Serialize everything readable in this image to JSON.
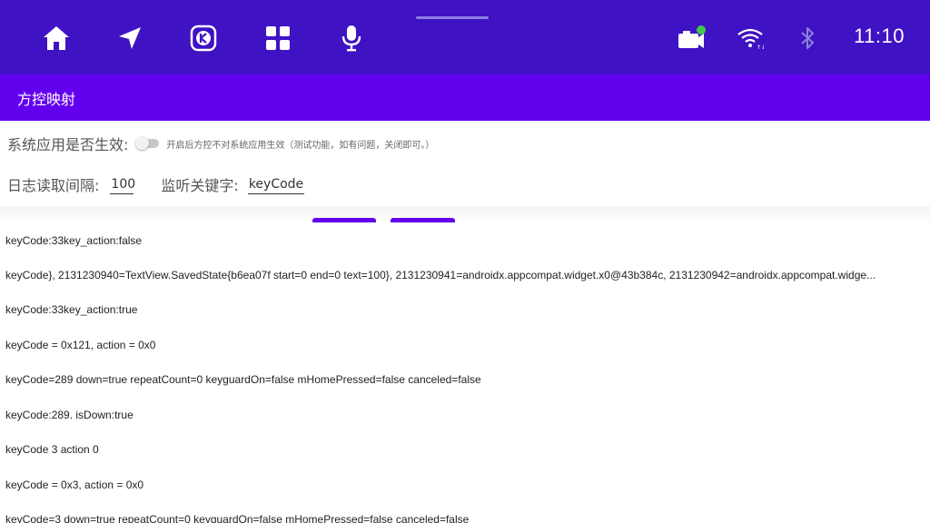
{
  "status_bar": {
    "time": "11:10",
    "icons": [
      "home-icon",
      "navigation-icon",
      "kuwo-music-icon",
      "apps-grid-icon",
      "microphone-icon",
      "camera-icon",
      "wifi-icon",
      "bluetooth-icon"
    ],
    "colors": {
      "background": "#3f12c4",
      "camera_dot": "#3ec94a"
    }
  },
  "app_bar": {
    "title": "方控映射",
    "color": "#6200ee"
  },
  "settings": {
    "system_apps_label": "系统应用是否生效:",
    "system_apps_hint": "开启后方控不对系统应用生效（测试功能，如有问题，关闭即可。）",
    "system_apps_enabled": false,
    "log_interval_label": "日志读取间隔:",
    "log_interval_value": "100",
    "keyword_label": "监听关键字:",
    "keyword_value": "keyCode"
  },
  "log": {
    "lines": [
      "keyCode:33key_action:false",
      "keyCode}, 2131230940=TextView.SavedState{b6ea07f start=0 end=0 text=100}, 2131230941=androidx.appcompat.widget.x0@43b384c, 2131230942=androidx.appcompat.widge...",
      "keyCode:33key_action:true",
      "keyCode = 0x121, action = 0x0",
      "keyCode=289 down=true repeatCount=0 keyguardOn=false mHomePressed=false canceled=false",
      "keyCode:289. isDown:true",
      "keyCode 3 action 0",
      "keyCode = 0x3, action = 0x0",
      "keyCode=3 down=true repeatCount=0 keyguardOn=false mHomePressed=false canceled=false"
    ]
  }
}
